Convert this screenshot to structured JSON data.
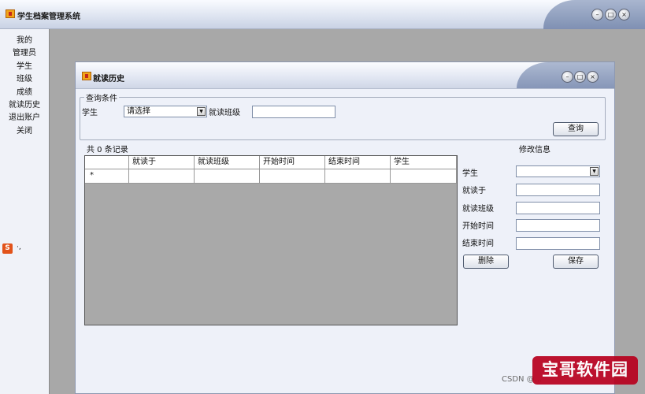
{
  "app": {
    "title": "学生档案管理系统"
  },
  "window_buttons": {
    "minimize": "–",
    "maximize": "□",
    "close": "×"
  },
  "sidebar": {
    "items": [
      {
        "label": "我的"
      },
      {
        "label": "管理员"
      },
      {
        "label": "学生"
      },
      {
        "label": "班级"
      },
      {
        "label": "成绩"
      },
      {
        "label": "就读历史"
      },
      {
        "label": "退出账户"
      },
      {
        "label": "关闭"
      }
    ]
  },
  "ime": {
    "icon": "S",
    "dots": "·,",
    "icon_name": "sogou-ime-icon"
  },
  "child_window": {
    "title": "就读历史"
  },
  "query": {
    "group_title": "查询条件",
    "student_label": "学生",
    "student_select": "请选择",
    "class_label": "就读班级",
    "class_value": "",
    "search_button": "查询"
  },
  "records": {
    "count_text": "共 0 条记录"
  },
  "grid": {
    "columns": [
      "",
      "就读于",
      "就读班级",
      "开始时间",
      "结束时间",
      "学生"
    ],
    "new_row_marker": "*"
  },
  "edit": {
    "title": "修改信息",
    "student_label": "学生",
    "school_label": "就读于",
    "class_label": "就读班级",
    "start_label": "开始时间",
    "end_label": "结束时间",
    "delete_button": "删除",
    "save_button": "保存"
  },
  "watermark": {
    "csdn": "CSDN @...",
    "logo": "宝哥软件园"
  },
  "colors": {
    "mdi_background": "#a8a8a8",
    "grid_background": "#a9a9a9",
    "window_background": "#eef1f9"
  }
}
